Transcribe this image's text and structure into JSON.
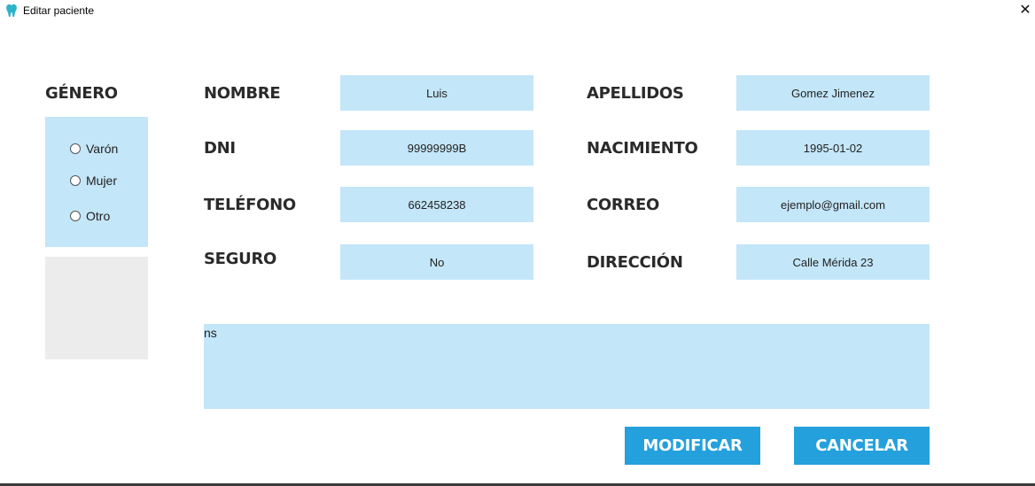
{
  "window": {
    "title": "Editar paciente",
    "close_glyph": "✕",
    "app_icon": "tooth-icon",
    "accent_color": "#24a0dc",
    "field_color": "#c3e6f8"
  },
  "gender": {
    "label": "GÉNERO",
    "options": [
      "Varón",
      "Mujer",
      "Otro"
    ],
    "selected": null
  },
  "fields": {
    "nombre": {
      "label": "NOMBRE",
      "value": "Luis"
    },
    "apellidos": {
      "label": "APELLIDOS",
      "value": "Gomez Jimenez"
    },
    "dni": {
      "label": "DNI",
      "value": "99999999B"
    },
    "nacimiento": {
      "label": "NACIMIENTO",
      "value": "1995-01-02"
    },
    "telefono": {
      "label": "TELÉFONO",
      "value": "662458238"
    },
    "correo": {
      "label": "CORREO",
      "value": "ejemplo@gmail.com"
    },
    "seguro": {
      "label": "SEGURO",
      "value": "No"
    },
    "direccion": {
      "label": "DIRECCIÓN",
      "value": "Calle Mérida 23"
    }
  },
  "notes": {
    "value": "ns"
  },
  "buttons": {
    "modificar": "MODIFICAR",
    "cancelar": "CANCELAR"
  }
}
